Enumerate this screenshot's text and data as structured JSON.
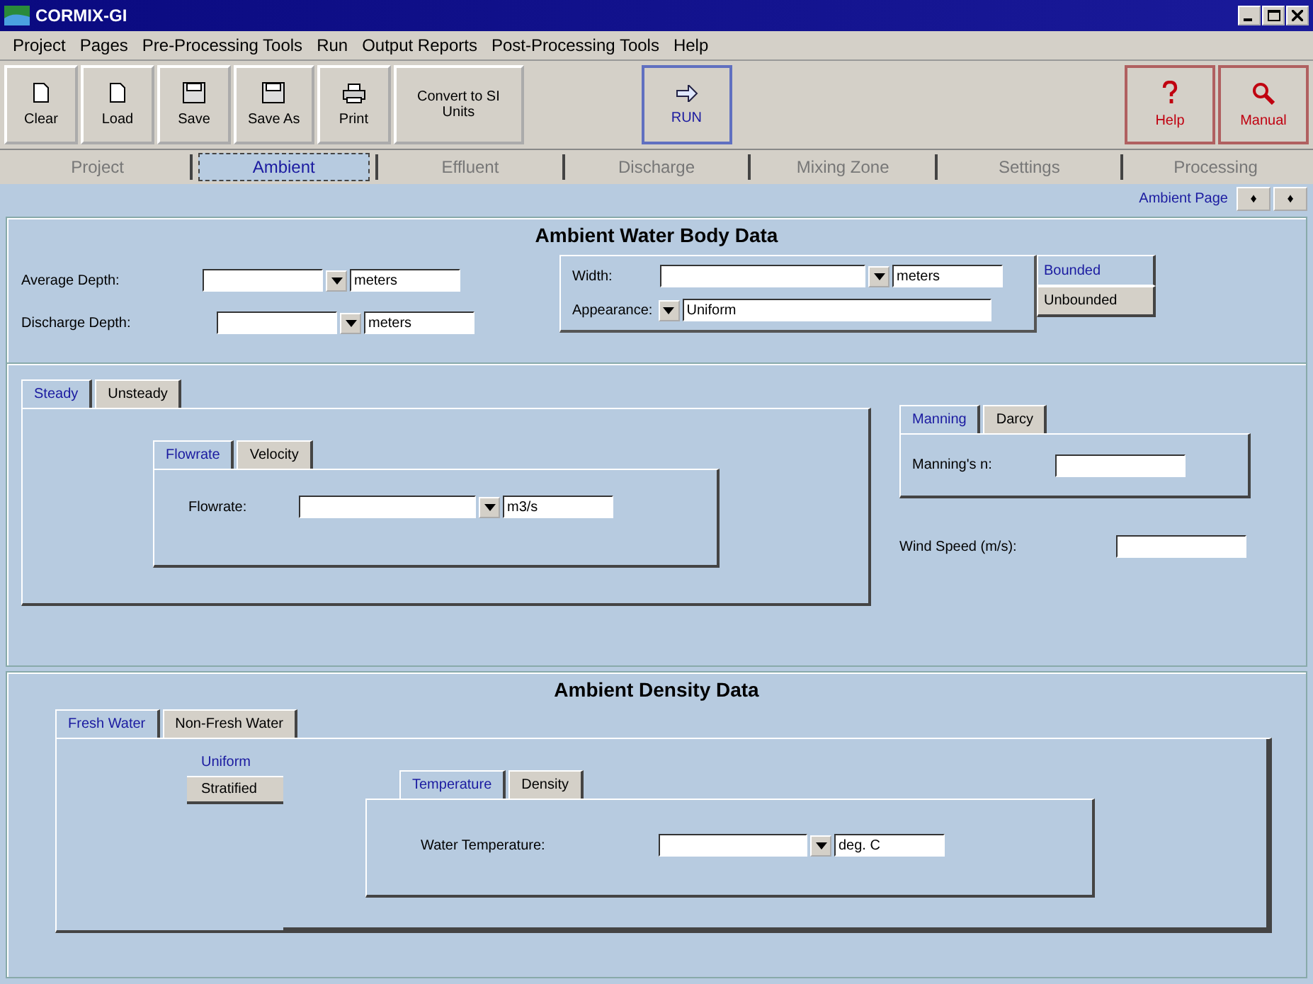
{
  "window": {
    "title": "CORMIX-GI"
  },
  "menu": [
    "Project",
    "Pages",
    "Pre-Processing Tools",
    "Run",
    "Output Reports",
    "Post-Processing Tools",
    "Help"
  ],
  "toolbar": {
    "left": [
      {
        "label": "Clear",
        "kind": "doc"
      },
      {
        "label": "Load",
        "kind": "doc"
      },
      {
        "label": "Save",
        "kind": "save"
      },
      {
        "label": "Save As",
        "kind": "save"
      },
      {
        "label": "Print",
        "kind": "print"
      },
      {
        "label": "Convert to SI Units",
        "kind": "text"
      }
    ],
    "center": [
      {
        "label": "RUN",
        "kind": "run"
      }
    ],
    "right": [
      {
        "label": "Help",
        "kind": "help"
      },
      {
        "label": "Manual",
        "kind": "search"
      }
    ]
  },
  "page_tabs": [
    {
      "label": "Project",
      "selected": false
    },
    {
      "label": "Ambient",
      "selected": true
    },
    {
      "label": "Effluent",
      "selected": false
    },
    {
      "label": "Discharge",
      "selected": false
    },
    {
      "label": "Mixing Zone",
      "selected": false
    },
    {
      "label": "Settings",
      "selected": false
    },
    {
      "label": "Processing",
      "selected": false
    }
  ],
  "page_nav": {
    "label": "Ambient Page",
    "buttons": [
      "♦",
      "♦"
    ]
  },
  "water_body": {
    "title": "Ambient Water Body Data",
    "depths": [
      {
        "label": "Average Depth:",
        "unit": "meters"
      },
      {
        "label": "Discharge Depth:",
        "unit": "meters"
      }
    ],
    "width": {
      "label": "Width:",
      "unit": "meters"
    },
    "appearance": {
      "label": "Appearance:",
      "value": "Uniform"
    },
    "boundary": [
      {
        "label": "Bounded",
        "selected": true
      },
      {
        "label": "Unbounded",
        "selected": false
      }
    ],
    "flow_tabs": [
      {
        "label": "Steady",
        "selected": true
      },
      {
        "label": "Unsteady",
        "selected": false
      }
    ],
    "flow_subtabs": [
      {
        "label": "Flowrate",
        "selected": true
      },
      {
        "label": "Velocity",
        "selected": false
      }
    ],
    "flowrate": {
      "label": "Flowrate:",
      "unit": "m3/s"
    },
    "friction_tabs": [
      {
        "label": "Manning",
        "selected": true
      },
      {
        "label": "Darcy",
        "selected": false
      }
    ],
    "manning": {
      "label": "Manning's n:"
    },
    "wind": {
      "label": "Wind Speed (m/s):"
    }
  },
  "density": {
    "title": "Ambient Density Data",
    "water_tabs": [
      {
        "label": "Fresh Water",
        "selected": true
      },
      {
        "label": "Non-Fresh Water",
        "selected": false
      }
    ],
    "profile": [
      {
        "label": "Uniform",
        "selected": true
      },
      {
        "label": "Stratified",
        "selected": false
      }
    ],
    "param_tabs": [
      {
        "label": "Temperature",
        "selected": true
      },
      {
        "label": "Density",
        "selected": false
      }
    ],
    "temperature": {
      "label": "Water Temperature:",
      "unit": "deg. C"
    }
  }
}
